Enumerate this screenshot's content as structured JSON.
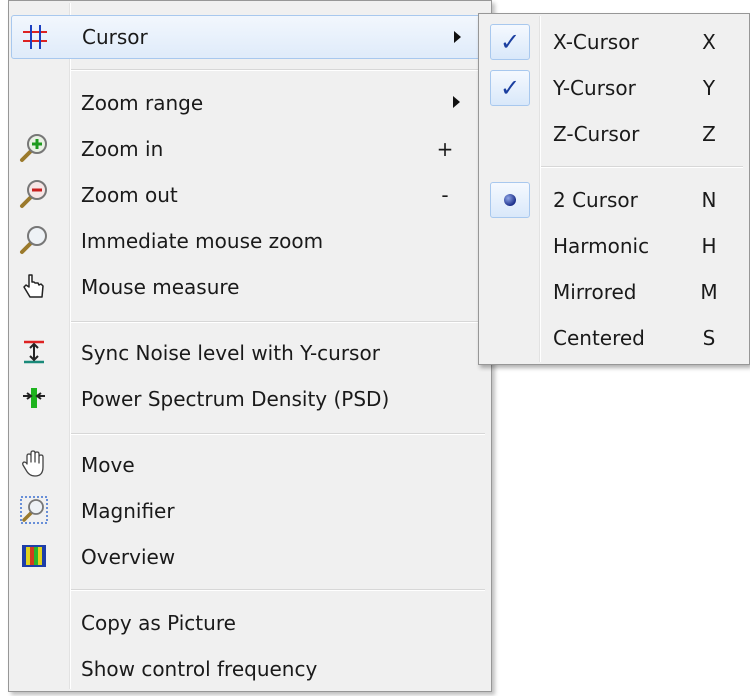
{
  "main_menu": {
    "items": [
      {
        "label": "Cursor",
        "icon": "cursor-grid-icon",
        "has_submenu": true,
        "highlighted": true
      },
      {
        "label": "Zoom range",
        "icon": "",
        "has_submenu": true
      },
      {
        "label": "Zoom in",
        "icon": "zoom-in-icon",
        "shortcut": "+"
      },
      {
        "label": "Zoom out",
        "icon": "zoom-out-icon",
        "shortcut": "-"
      },
      {
        "label": "Immediate mouse zoom",
        "icon": "magnifier-icon"
      },
      {
        "label": "Mouse measure",
        "icon": "pointing-hand-icon"
      },
      {
        "label": "Sync Noise level with Y-cursor",
        "icon": "sync-noise-icon"
      },
      {
        "label": "Power Spectrum Density (PSD)",
        "icon": "psd-icon"
      },
      {
        "label": "Move",
        "icon": "open-hand-icon"
      },
      {
        "label": "Magnifier",
        "icon": "magnifier-box-icon"
      },
      {
        "label": "Overview",
        "icon": "overview-icon"
      },
      {
        "label": "Copy as Picture",
        "icon": ""
      },
      {
        "label": "Show control frequency",
        "icon": ""
      }
    ]
  },
  "sub_menu": {
    "items": [
      {
        "label": "X-Cursor",
        "shortcut": "X",
        "checked": true
      },
      {
        "label": "Y-Cursor",
        "shortcut": "Y",
        "checked": true
      },
      {
        "label": "Z-Cursor",
        "shortcut": "Z",
        "checked": false
      },
      {
        "label": "2 Cursor",
        "shortcut": "N",
        "selected": true
      },
      {
        "label": "Harmonic",
        "shortcut": "H",
        "selected": false
      },
      {
        "label": "Mirrored",
        "shortcut": "M",
        "selected": false
      },
      {
        "label": "Centered",
        "shortcut": "S",
        "selected": false
      }
    ]
  },
  "check_glyph": "✓",
  "colors": {
    "highlight_border": "#a8c8ee",
    "menu_bg": "#f0f0f0",
    "check": "#1b3fa0"
  }
}
